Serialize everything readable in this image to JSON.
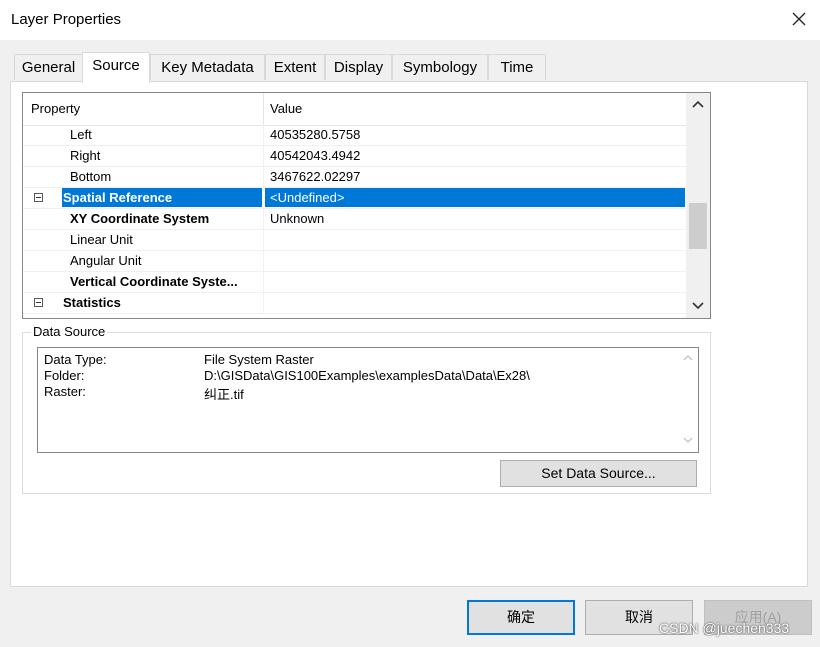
{
  "window": {
    "title": "Layer Properties"
  },
  "tabs": [
    {
      "label": "General"
    },
    {
      "label": "Source"
    },
    {
      "label": "Key Metadata"
    },
    {
      "label": "Extent"
    },
    {
      "label": "Display"
    },
    {
      "label": "Symbology"
    },
    {
      "label": "Time"
    }
  ],
  "active_tab": "Source",
  "property_grid": {
    "header_property": "Property",
    "header_value": "Value",
    "rows": [
      {
        "name": "Left",
        "value": "40535280.5758"
      },
      {
        "name": "Right",
        "value": "40542043.4942"
      },
      {
        "name": "Bottom",
        "value": "3467622.02297"
      },
      {
        "name": "Spatial Reference",
        "value": "<Undefined>"
      },
      {
        "name": "XY Coordinate System",
        "value": "Unknown"
      },
      {
        "name": "Linear Unit",
        "value": ""
      },
      {
        "name": "Angular Unit",
        "value": ""
      },
      {
        "name": "Vertical Coordinate Syste...",
        "value": ""
      },
      {
        "name": "Statistics",
        "value": ""
      }
    ]
  },
  "data_source": {
    "legend": "Data Source",
    "lines": [
      {
        "label": "Data Type:",
        "value": "File System Raster"
      },
      {
        "label": "Folder:",
        "value": "D:\\GISData\\GIS100Examples\\examplesData\\Data\\Ex28\\"
      },
      {
        "label": "Raster:",
        "value": "纠正.tif"
      }
    ],
    "set_button": "Set Data Source..."
  },
  "buttons": {
    "ok": "确定",
    "cancel": "取消",
    "apply": "应用(A)"
  },
  "watermark": "CSDN @juechen333",
  "colors": {
    "selection": "#0078d7",
    "default_button_border": "#0078d7"
  }
}
